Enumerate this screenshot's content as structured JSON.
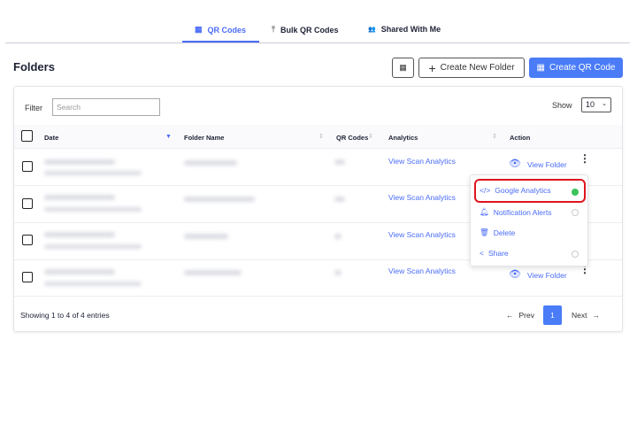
{
  "tabs": [
    {
      "label": "QR Codes",
      "icon": "qr-icon",
      "active": true
    },
    {
      "label": "Bulk QR Codes",
      "icon": "upload-icon"
    },
    {
      "label": "Shared With Me",
      "icon": "users-icon"
    }
  ],
  "page_title": "Folders",
  "toolbar": {
    "grid_icon": "grid-icon",
    "create_folder": "Create New Folder",
    "create_qr": "Create QR Code"
  },
  "filter": {
    "label": "Filter",
    "placeholder": "Search"
  },
  "show": {
    "label": "Show",
    "value": "10"
  },
  "columns": [
    "Date",
    "Folder Name",
    "QR Codes",
    "Analytics",
    "Action"
  ],
  "rows": [
    {
      "analytics": "View Scan Analytics",
      "action": "View Folder"
    },
    {
      "analytics": "View Scan Analytics"
    },
    {
      "analytics": "View Scan Analytics"
    },
    {
      "analytics": "View Scan Analytics",
      "action": "View Folder"
    }
  ],
  "menu": [
    {
      "label": "Google Analytics",
      "icon": "code-icon",
      "enabled": true
    },
    {
      "label": "Notification Alerts",
      "icon": "bell-icon"
    },
    {
      "label": "Delete",
      "icon": "trash-icon"
    },
    {
      "label": "Share",
      "icon": "share-icon"
    }
  ],
  "footer": {
    "info": "Showing 1 to 4 of 4 entries",
    "prev": "Prev",
    "page": "1",
    "next": "Next"
  },
  "colors": {
    "accent": "#4a6cf7",
    "highlight": "#e0141e",
    "success": "#3cc35a"
  }
}
